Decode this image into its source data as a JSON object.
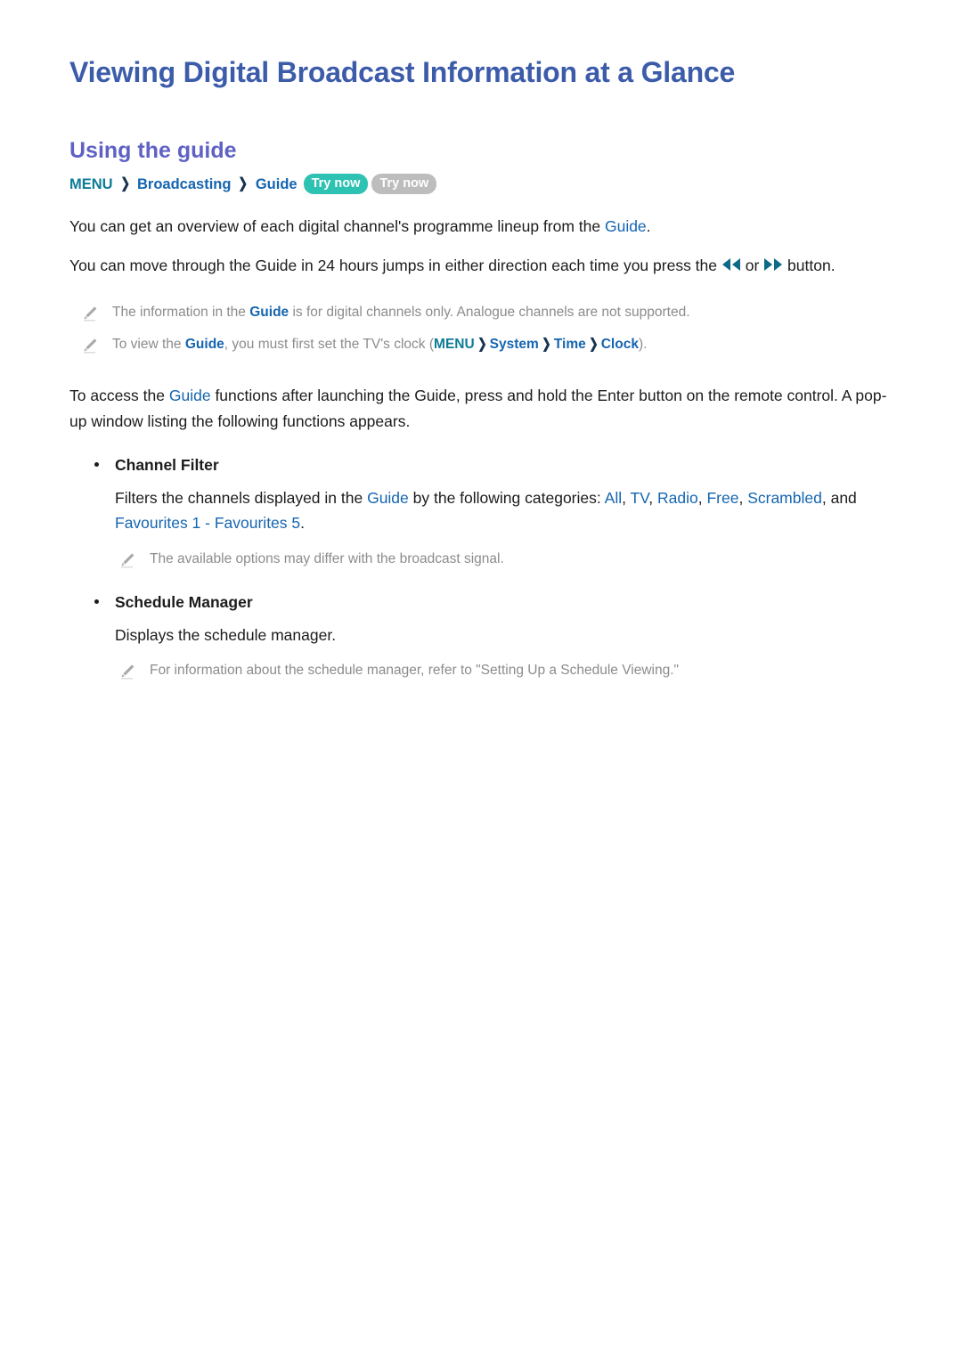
{
  "document": {
    "title": "Viewing Digital Broadcast Information at a Glance",
    "section_heading": "Using the guide"
  },
  "colors": {
    "title": "#3c5caa",
    "section_heading": "#5f62c4",
    "link_blue": "#1565b0",
    "menu_teal": "#0e7c96",
    "badge_teal": "#2ec2b3",
    "badge_gray": "#bdbdbd",
    "note_gray": "#8c8c8c",
    "body_text": "#1c1c1c"
  },
  "breadcrumb": {
    "menu": "MENU",
    "separator": "❯",
    "item_broadcasting": "Broadcasting",
    "item_guide": "Guide",
    "badge_active": "Try now",
    "badge_inactive": "Try now"
  },
  "paragraphs": {
    "intro_1_a": "You can get an overview of each digital channel's programme lineup from the ",
    "intro_1_kw": "Guide",
    "intro_1_b": ".",
    "intro_2_a": "You can move through the Guide in 24 hours jumps in either direction each time you press the ",
    "intro_2_or": " or ",
    "intro_2_b": " button.",
    "access_a": "To access the ",
    "access_kw": "Guide",
    "access_b": " functions after launching the Guide, press and hold the Enter button on the remote control. A pop-up window listing the following functions appears."
  },
  "icons": {
    "rewind": "rewind-icon",
    "fast_forward": "fast-forward-icon",
    "note_pencil": "pencil-icon",
    "chevron": "chevron-right-icon"
  },
  "notes": [
    {
      "segments_a": "The information in the ",
      "kw": "Guide",
      "segments_b": " is for digital channels only. Analogue channels are not supported."
    },
    {
      "segments_a": "To view the ",
      "kw": "Guide",
      "segments_b": ", you must first set the TV's clock (",
      "menu": "MENU",
      "path_1": "System",
      "path_2": "Time",
      "path_3": "Clock",
      "segments_c": ")."
    },
    {
      "text": "The available options may differ with the broadcast signal."
    },
    {
      "text": "For information about the schedule manager, refer to \"Setting Up a Schedule Viewing.\""
    }
  ],
  "bullets": {
    "channel_filter": {
      "label": "Channel Filter",
      "desc_a": "Filters the channels displayed in the ",
      "desc_kw_guide": "Guide",
      "desc_b": " by the following categories: ",
      "cat_all": "All",
      "cat_tv": "TV",
      "cat_radio": "Radio",
      "cat_free": "Free",
      "cat_scrambled": "Scrambled",
      "desc_and": ", and ",
      "cat_fav_range": "Favourites 1 - Favourites 5",
      "desc_end": "."
    },
    "schedule_manager": {
      "label": "Schedule Manager",
      "desc": "Displays the schedule manager."
    }
  }
}
